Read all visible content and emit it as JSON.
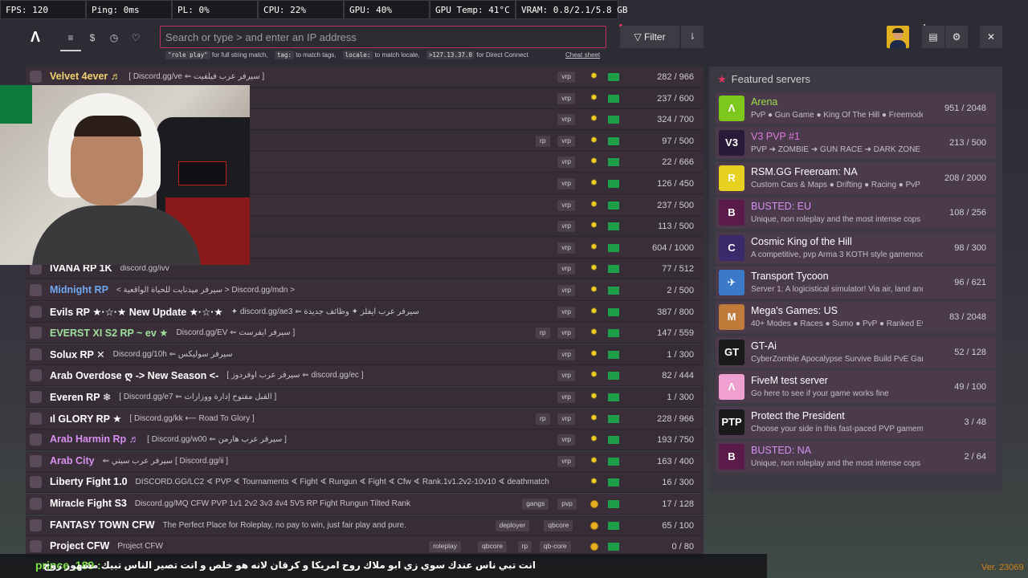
{
  "perf": [
    "FPS: 120",
    "Ping: 0ms",
    "PL: 0%",
    "CPU: 22%",
    "GPU: 40%",
    "GPU Temp: 41°C",
    "VRAM: 0.8/2.1/5.8 GB"
  ],
  "nav": {
    "logo": "Λ",
    "icons": [
      "list-icon",
      "dollar-icon",
      "history-icon",
      "heart-icon"
    ],
    "icon_glyphs": [
      "≡",
      "$",
      "◷",
      "♡"
    ],
    "search_placeholder": "Search or type > and enter an IP address",
    "filter_label": "Filter",
    "sort_glyph": "⇂",
    "notif_count": "1",
    "close_glyph": "✕"
  },
  "hints": [
    {
      "code": "\"role play\"",
      "text": "for full string match,"
    },
    {
      "code": "tag:",
      "text": "to match tags,"
    },
    {
      "code": "locale:",
      "text": "to match locale,"
    },
    {
      "code": ">127.13.37.0",
      "text": "for Direct Connect"
    }
  ],
  "cheat_sheet": "Cheat sheet",
  "servers": [
    {
      "name": "Velvet 4ever ♬",
      "color": "#f0d070",
      "desc": "[ Discord.gg/ve ⇐ سيرفر عرب فيلفيت ]",
      "tags": [
        "vrp"
      ],
      "badge": "sun",
      "count": "282 / 966"
    },
    {
      "name": "",
      "color": "#ffffff",
      "desc": "",
      "tags": [
        "vrp"
      ],
      "badge": "sun",
      "count": "237 / 600"
    },
    {
      "name": "",
      "color": "#ffffff",
      "desc": "",
      "tags": [
        "vrp"
      ],
      "badge": "sun",
      "count": "324 / 700"
    },
    {
      "name": "",
      "color": "#ffffff",
      "desc": "",
      "tags": [
        "rp",
        "vrp"
      ],
      "badge": "sun",
      "count": "97 / 500"
    },
    {
      "name": "",
      "color": "#ffffff",
      "desc": ".gg/U7 ⇐ سيرفر عرب رويال ]",
      "tags": [
        "vrp"
      ],
      "badge": "sun",
      "count": "22 / 666"
    },
    {
      "name": "",
      "color": "#ffffff",
      "desc": "حياة ]",
      "tags": [
        "vrp"
      ],
      "badge": "sun",
      "count": "126 / 450"
    },
    {
      "name": "",
      "color": "#ffffff",
      "desc": "",
      "tags": [
        "vrp"
      ],
      "badge": "sun",
      "count": "237 / 500"
    },
    {
      "name": "",
      "color": "#ffffff",
      "desc": "",
      "tags": [
        "vrp"
      ],
      "badge": "sun",
      "count": "113 / 500"
    },
    {
      "name": "",
      "color": "#ffffff",
      "desc": "",
      "tags": [
        "vrp"
      ],
      "badge": "sun",
      "count": "604 / 1000"
    },
    {
      "name": "IVANA RP 1K",
      "color": "#ffffff",
      "desc": "discord.gg/ivv",
      "tags": [
        "vrp"
      ],
      "badge": "sun",
      "count": "77 / 512"
    },
    {
      "name": "Midnight RP",
      "color": "#6fa8f0",
      "desc": "< سيرفر ميدنايت للحياة الواقعية > Discord.gg/mdn >",
      "tags": [
        "vrp"
      ],
      "badge": "sun",
      "count": "2 / 500"
    },
    {
      "name": "Evils RP ★·☆·★ New Update ★·☆·★",
      "color": "#ffffff",
      "desc": "✦ discord.gg/ae3 ⇐ سيرفر عرب ايفلز ✦ وظائف جديدة",
      "tags": [
        "vrp"
      ],
      "badge": "sun",
      "count": "387 / 800"
    },
    {
      "name": "EVERST XI S2 RP ~ ev ★",
      "color": "#9fe09f",
      "desc": "Discord.gg/EV ⇐ سيرفر ايفرست ]",
      "tags": [
        "rp",
        "vrp"
      ],
      "badge": "sun",
      "count": "147 / 559"
    },
    {
      "name": "Solux RP ✕",
      "color": "#ffffff",
      "desc": "Discord.gg/10h ⇐ سيرفر سوليكس",
      "tags": [
        "vrp"
      ],
      "badge": "sun",
      "count": "1 / 300"
    },
    {
      "name": "Arab Overdose ღ -> New Season <-",
      "color": "#ffffff",
      "desc": "[ سيرفر عرب اوفردوز ⇐ discord.gg/ec ]",
      "tags": [
        "vrp"
      ],
      "badge": "sun",
      "count": "82 / 444"
    },
    {
      "name": "Everen RP ❄",
      "color": "#ffffff",
      "desc": "[ Discord.gg/e7 ⇐ القبل مفتوح إدارة ووزارات ]",
      "tags": [
        "vrp"
      ],
      "badge": "sun",
      "count": "1 / 300"
    },
    {
      "name": "ıl GLORY RP ★",
      "color": "#ffffff",
      "desc": "[ Discord.gg/kk ⟵ Road To Glory ]",
      "tags": [
        "rp",
        "vrp"
      ],
      "badge": "sun",
      "count": "228 / 966"
    },
    {
      "name": "Arab Harmin Rp ♬",
      "color": "#d890f0",
      "desc": "[ Discord.gg/w00 ⇐ سيرفر عرب هارمن ]",
      "tags": [
        "vrp"
      ],
      "badge": "sun",
      "count": "193 / 750"
    },
    {
      "name": "Arab City",
      "color": "#d890f0",
      "desc": "⇐ سيرفر عرب سيتي [ Discord.gg/ii ]",
      "tags": [
        "vrp"
      ],
      "badge": "sun",
      "count": "163 / 400"
    },
    {
      "name": "Liberty Fight 1.0",
      "color": "#ffffff",
      "desc": "DISCORD.GG/LC2 ∢ PVP ∢ Tournaments ∢ Fight ∢ Rungun ∢ Fight ∢ Cfw ∢ Rank.1v1.2v2-10v10 ∢ deathmatch",
      "tags": [],
      "badge": "sun",
      "count": "16 / 300"
    },
    {
      "name": "Miracle Fight S3",
      "color": "#ffffff",
      "desc": "Discord.gg/MQ CFW PVP 1v1 2v2 3v3 4v4 5V5 RP Fight Rungun Tilted Rank",
      "tags": [
        "gangs",
        "pvp"
      ],
      "badge": "coin",
      "count": "17 / 128"
    },
    {
      "name": "FANTASY TOWN CFW",
      "color": "#ffffff",
      "desc": "The Perfect Place for Roleplay, no pay to win, just fair play and pure.",
      "tags": [
        "deployer",
        "qbcore"
      ],
      "badge": "coin",
      "count": "65 / 100"
    },
    {
      "name": "Project CFW",
      "color": "#ffffff",
      "desc": "Project CFW",
      "tags": [
        "roleplay",
        "qbcore",
        "rp",
        "qb-core"
      ],
      "badge": "coin",
      "count": "0 / 80"
    }
  ],
  "featured": {
    "title": "Featured servers",
    "items": [
      {
        "name": "Arena",
        "name_color": "#9fe04a",
        "desc": "PvP ● Gun Game ● King Of The Hill ● Freemode",
        "count": "951 / 2048",
        "ico": "Λ",
        "ico_bg": "#7ec81e"
      },
      {
        "name": "V3 PVP #1",
        "name_color": "#e07ae0",
        "desc": "PVP ➜ ZOMBIE ➜ GUN RACE ➜ DARK ZONE ➜ F",
        "count": "213 / 500",
        "ico": "V3",
        "ico_bg": "#2a1a3a"
      },
      {
        "name": "RSM.GG Freeroam: NA",
        "name_color": "#ffffff",
        "desc": "Custom Cars & Maps ● Drifting ● Racing ● PvP",
        "count": "208 / 2000",
        "ico": "R",
        "ico_bg": "#e8d020"
      },
      {
        "name": "BUSTED: EU",
        "name_color": "#d890f0",
        "desc": "Unique, non roleplay and the most intense cops",
        "count": "108 / 256",
        "ico": "B",
        "ico_bg": "#5a1a4a"
      },
      {
        "name": "Cosmic King of the Hill",
        "name_color": "#ffffff",
        "desc": "A competitive, pvp Arma 3 KOTH style gamemode",
        "count": "98 / 300",
        "ico": "C",
        "ico_bg": "#3a2a6a"
      },
      {
        "name": "Transport Tycoon",
        "name_color": "#ffffff",
        "desc": "Server 1: A logicistical simulator! Via air, land and se",
        "count": "96 / 621",
        "ico": "✈",
        "ico_bg": "#3a7ac8"
      },
      {
        "name": "Mega's Games: US",
        "name_color": "#ffffff",
        "desc": "40+ Modes ● Races ● Sumo ● PvP ● Ranked Eve",
        "count": "83 / 2048",
        "ico": "M",
        "ico_bg": "#c07a3a"
      },
      {
        "name": "GT-Ai",
        "name_color": "#ffffff",
        "desc": "CyberZombie Apocalypse Survive Build PvE Gang",
        "count": "52 / 128",
        "ico": "GT",
        "ico_bg": "#1a1a1a"
      },
      {
        "name": "FiveM test server",
        "name_color": "#ffffff",
        "desc": "Go here to see if your game works fine",
        "count": "49 / 100",
        "ico": "Λ",
        "ico_bg": "#f0a0d0"
      },
      {
        "name": "Protect the President",
        "name_color": "#ffffff",
        "desc": "Choose your side in this fast-paced PVP gamemode",
        "count": "3 / 48",
        "ico": "PTP",
        "ico_bg": "#1a1a1a"
      },
      {
        "name": "BUSTED: NA",
        "name_color": "#d890f0",
        "desc": "Unique, non roleplay and the most intense cops vs r",
        "count": "2 / 64",
        "ico": "B",
        "ico_bg": "#5a1a4a"
      }
    ]
  },
  "chat": {
    "user": "prince_189 :",
    "message": "انت تبي ناس عندك سوي زي ابو ملاك روح امريكا و كرقان لانه هو خلص و انت تصير الناس تبيك مشهور روح"
  },
  "version": "Ver. 23069"
}
